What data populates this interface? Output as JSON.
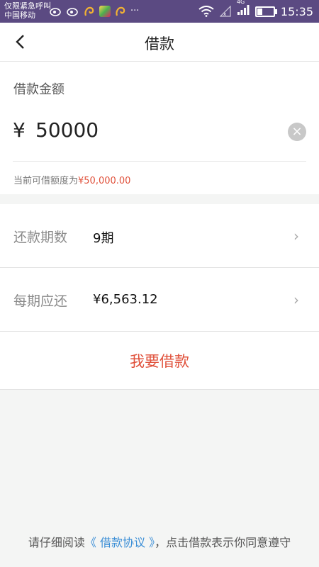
{
  "status_bar": {
    "carrier_line1": "仅限紧急呼叫",
    "carrier_line2": "中国移动",
    "network": "4G",
    "time": "15:35",
    "icons": [
      "weibo-icon",
      "weibo-icon",
      "squirrel-icon",
      "app-icon",
      "squirrel-icon",
      "more-icon",
      "wifi-icon",
      "signal-icon",
      "signal-icon",
      "battery-icon"
    ]
  },
  "nav": {
    "title": "借款"
  },
  "amount": {
    "label": "借款金额",
    "currency": "¥",
    "value": "50000",
    "limit_prefix": "当前可借额度为",
    "limit_value": "¥50,000.00"
  },
  "rows": {
    "term": {
      "label": "还款期数",
      "value": "9期"
    },
    "per_period": {
      "label": "每期应还",
      "value": "¥6,563.12"
    }
  },
  "submit_label": "我要借款",
  "agreement": {
    "prefix": "请仔细阅读",
    "link": "《 借款协议 》",
    "suffix": "，点击借款表示你同意遵守"
  },
  "colors": {
    "accent_red": "#e0513b",
    "link_blue": "#3b8ed6",
    "status_bar": "#5b4a82"
  }
}
